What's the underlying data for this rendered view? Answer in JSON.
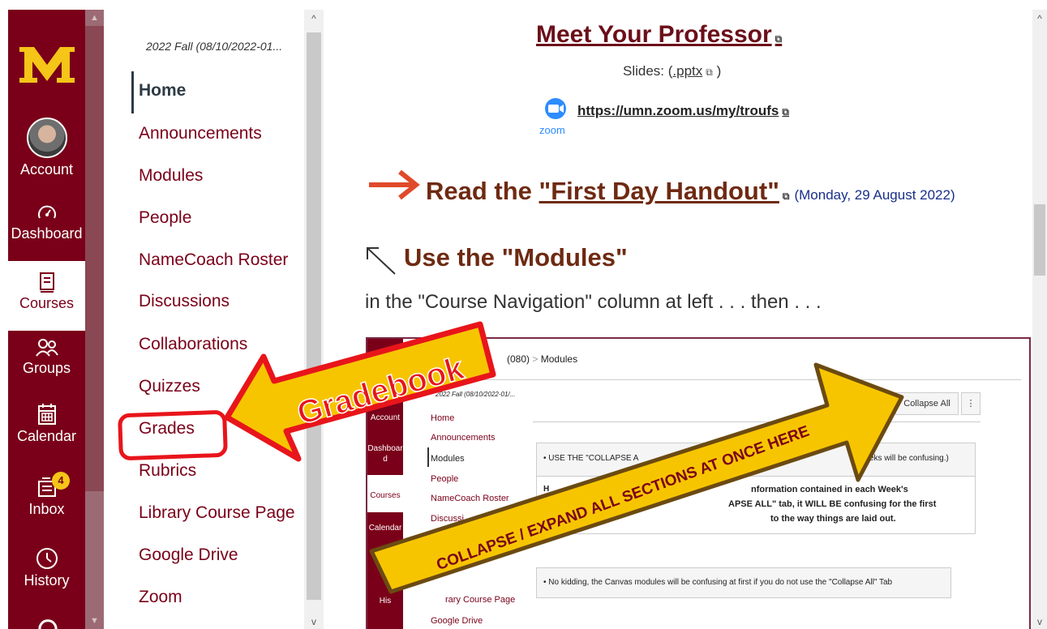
{
  "global_nav": {
    "account": "Account",
    "dashboard": "Dashboard",
    "courses": "Courses",
    "groups": "Groups",
    "calendar": "Calendar",
    "inbox": "Inbox",
    "inbox_badge": "4",
    "history": "History"
  },
  "course_nav": {
    "term": "2022 Fall (08/10/2022-01...",
    "items": [
      "Home",
      "Announcements",
      "Modules",
      "People",
      "NameCoach Roster",
      "Discussions",
      "Collaborations",
      "Quizzes",
      "Grades",
      "Rubrics",
      "Library Course Page",
      "Google Drive",
      "Zoom"
    ]
  },
  "main": {
    "professor_heading": "Meet Your Professor",
    "slides_prefix": "Slides: (",
    "slides_link": ".pptx",
    "slides_suffix": ")",
    "zoom_label": "zoom",
    "zoom_link": "https://umn.zoom.us/my/troufs",
    "read_prefix": "Read the ",
    "read_link": "\"First Day Handout\"",
    "read_date": "(Monday, 29 August 2022)",
    "modules_heading": "Use the \"Modules\"",
    "paragraph": "in the \"Course Navigation\" column at left . . . then . . ."
  },
  "embedded": {
    "breadcrumb_code": "(080)",
    "breadcrumb_sep": ">",
    "breadcrumb": "Modules",
    "term": "2022 Fall (08/10/2022-01/...",
    "collapse_all": "Collapse All",
    "kebab": "⋮",
    "nav": [
      "Home",
      "Announcements",
      "Modules",
      "People",
      "NameCoach Roster",
      "Discussi",
      "rary Course Page",
      "Google Drive"
    ],
    "gnav": [
      "Account",
      "Dashboar",
      "d",
      "Courses",
      "Calendar",
      "His"
    ],
    "note1_left": "• USE THE \"COLLAPSE A",
    "note1_right": "eks will be confusing.)",
    "para_line1": "nformation contained in each Week's",
    "para_line2": "APSE ALL\" tab, it WILL BE confusing for the first",
    "para_line3": "to the way things are laid out.",
    "para_left": "H",
    "note2": "• No kidding, the Canvas modules will be confusing at first if you do not use the \"Collapse All\" Tab"
  },
  "callouts": {
    "gradebook": "Gradebook",
    "collapse": "COLLAPSE / EXPAND ALL SECTIONS AT ONCE HERE"
  },
  "colors": {
    "maroon": "#7a0019",
    "gold": "#f5c518",
    "red": "#e8151b"
  }
}
